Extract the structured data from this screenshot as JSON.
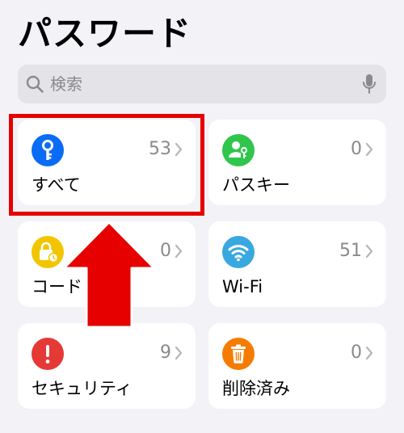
{
  "header": {
    "title": "パスワード"
  },
  "search": {
    "placeholder": "検索",
    "value": ""
  },
  "categories": [
    {
      "label": "すべて",
      "count": "53",
      "icon": "key-icon",
      "color": "#0a6cf5"
    },
    {
      "label": "パスキー",
      "count": "0",
      "icon": "passkey-person-icon",
      "color": "#2fc64b"
    },
    {
      "label": "コード",
      "count": "0",
      "icon": "lock-clock-icon",
      "color": "#f2c500"
    },
    {
      "label": "Wi-Fi",
      "count": "51",
      "icon": "wifi-icon",
      "color": "#3aa8e0"
    },
    {
      "label": "セキュリティ",
      "count": "9",
      "icon": "exclamation-icon",
      "color": "#e53935"
    },
    {
      "label": "削除済み",
      "count": "0",
      "icon": "trash-icon",
      "color": "#f57c00"
    }
  ],
  "annotation": {
    "highlight_color": "#e60000"
  }
}
